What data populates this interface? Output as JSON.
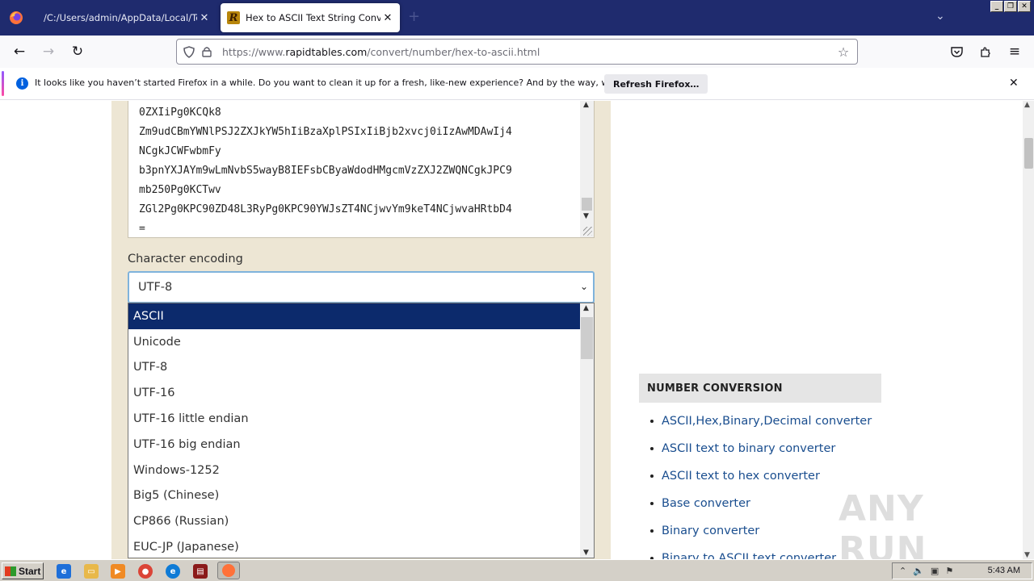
{
  "browser": {
    "tabs": [
      {
        "title": "/C:/Users/admin/AppData/Local/Temp/h",
        "close": "✕"
      },
      {
        "title": "Hex to ASCII Text String Converte",
        "close": "✕",
        "favicon": "R"
      }
    ],
    "new_tab": "+",
    "url_prefix": "https://www.",
    "url_host": "rapidtables.com",
    "url_path": "/convert/number/hex-to-ascii.html"
  },
  "notification": {
    "icon": "i",
    "text": "It looks like you haven’t started Firefox in a while. Do you want to clean it up for a fresh, like-new experience? And by the way, welcome back!",
    "button": "Refresh Firefox…"
  },
  "output": {
    "lines": [
      "0ZXIiPg0KCQk8",
      "Zm9udCBmYWNlPSJ2ZXJkYW5hIiBzaXplPSIxIiBjb2xvcj0iIzAwMDAwIj4",
      "NCgkJCWFwbmFy",
      "b3pnYXJAYm9wLmNvbS5wayB8IEFsbCByaWdodHMgcmVzZXJ2ZWQNCgkJPC9",
      "mb250Pg0KCTwv",
      "ZGl2Pg0KPC90ZD48L3RyPg0KPC90YWJsZT4NCjwvYm9keT4NCjwvaHRtbD4",
      "="
    ]
  },
  "encoding": {
    "label": "Character encoding",
    "selected": "UTF-8",
    "options": [
      "ASCII",
      "Unicode",
      "UTF-8",
      "UTF-16",
      "UTF-16 little endian",
      "UTF-16 big endian",
      "Windows-1252",
      "Big5 (Chinese)",
      "CP866 (Russian)",
      "EUC-JP (Japanese)"
    ],
    "highlighted": "ASCII"
  },
  "sidebar": {
    "heading": "NUMBER CONVERSION",
    "links": [
      "ASCII,Hex,Binary,Decimal converter",
      "ASCII text to binary converter",
      "ASCII text to hex converter",
      "Base converter",
      "Binary converter",
      "Binary to ASCII text converter"
    ]
  },
  "watermark": "ANY RUN",
  "taskbar": {
    "start": "Start",
    "clock": "5:43 AM"
  }
}
